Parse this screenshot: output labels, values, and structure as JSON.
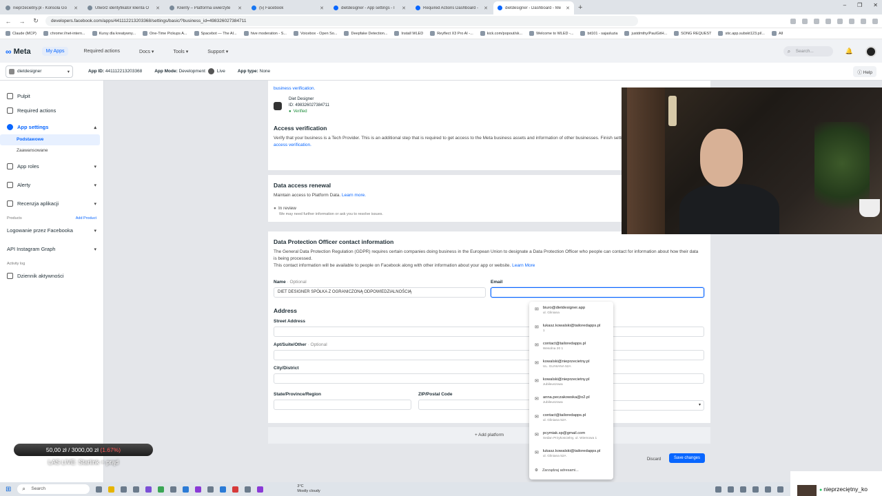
{
  "browser": {
    "tabs": [
      {
        "title": "nieprzecietny.pl - Konsola Go"
      },
      {
        "title": "Utwórz identyfikator klienta O"
      },
      {
        "title": "Klienty – Platforma uwierzyte"
      },
      {
        "title": "(5) Facebook"
      },
      {
        "title": "dietdesigner - App settings - I"
      },
      {
        "title": "Required Actions Dashboard -"
      },
      {
        "title": "dietdesigner - Dashboard - Me",
        "active": true
      }
    ],
    "new_tab": "+",
    "window_controls": [
      "–",
      "❐",
      "✕"
    ],
    "url": "developers.facebook.com/apps/441112213203368/settings/basic/?business_id=498326027384711",
    "bookmarks": [
      "Claude (MCP)",
      "chrome://net-intern...",
      "Kursy dla kreatywny...",
      "One-Time Pickups A...",
      "Spacebot — The AI...",
      "hive moderation - S...",
      "Voicebox - Open So...",
      "Deepfake Detection...",
      "Install WLED",
      "Reyflect X3 Pro AI -...",
      "kick.com/popout/sk...",
      "Welcome to WLED -...",
      "bit101 - sajasluzia",
      "justdmthy/PaulGitH...",
      "SONG REQUEST",
      "stic.app.subskt123.pl/...",
      "All"
    ]
  },
  "meta_header": {
    "logo": "Meta",
    "nav": [
      "My Apps",
      "Required actions",
      "Docs ▾",
      "Tools ▾",
      "Support ▾"
    ],
    "search_placeholder": "Search..."
  },
  "app_row": {
    "app_name": "dietdesigner",
    "app_id_label": "App ID:",
    "app_id": "441112213203368",
    "app_mode_label": "App Mode:",
    "app_mode": "Development",
    "live": "Live",
    "app_type_label": "App type:",
    "app_type": "None",
    "help": "Help"
  },
  "sidebar": {
    "items": [
      {
        "label": "Pulpit"
      },
      {
        "label": "Required actions"
      },
      {
        "label": "App settings"
      },
      {
        "label": "App roles"
      },
      {
        "label": "Alerty"
      },
      {
        "label": "Recenzja aplikacji"
      },
      {
        "label": "Logowanie przez Facebooka"
      },
      {
        "label": "API Instagram Graph"
      },
      {
        "label": "Dziennik aktywności"
      }
    ],
    "sub_items": [
      "Podstawowe",
      "Zaawansowane"
    ],
    "products_label": "Products",
    "add_product": "Add Product",
    "activity_log_label": "Activity log"
  },
  "business": {
    "verification_link": "business verification.",
    "name": "Diet Designer",
    "id_text": "ID: 498326027384711",
    "status": "Verified"
  },
  "access_verification": {
    "title": "Access verification",
    "desc": "Verify that your business is a Tech Provider. This is an additional step that is required to get access to the Meta business assets and information of other businesses. Finish setting it up within 5 days.",
    "link": "Learn about access verification."
  },
  "data_access": {
    "title": "Data access renewal",
    "desc": "Maintain access to Platform Data.",
    "link": "Learn more.",
    "status": "In review",
    "substatus": "We may need further information or ask you to resolve issues."
  },
  "dpo": {
    "title": "Data Protection Officer contact information",
    "desc1": "The General Data Protection Regulation (GDPR) requires certain companies doing business in the European Union to designate a Data Protection Officer who people can contact for information about how their data is being processed.",
    "desc2": "This contact information will be available to people on Facebook along with other information about your app or website.",
    "link": "Learn More",
    "name_label": "Name",
    "optional": "· Optional",
    "name_value": "DIET DESIGNER SPÓŁKA Z OGRANICZONĄ ODPOWIEDZIALNOŚCIĄ",
    "email_label": "Email",
    "email_value": "",
    "address_label": "Address",
    "street_label": "Street Address",
    "apt_label": "Apt/Suite/Other",
    "apt_optional": "· Optional",
    "city_label": "City/District",
    "state_label": "State/Province/Region",
    "zip_label": "ZIP/Postal Code"
  },
  "add_platform": "+ Add platform",
  "buttons": {
    "discard": "Discard",
    "save": "Save changes"
  },
  "autocomplete": {
    "items": [
      {
        "email": "biuro@dietdesigner.app",
        "sub": "ul. Gliniana"
      },
      {
        "email": "lukasz.kowalski@tailoredapps.pl",
        "sub": "1"
      },
      {
        "email": "contact@tailoredapps.pl",
        "sub": "Wesolna 20 1"
      },
      {
        "email": "kowalski@nieprzecietny.pl",
        "sub": "UL. GLINIANA 52A"
      },
      {
        "email": "kowalski@nieprzecietny.pl",
        "sub": "Jubileuszowa"
      },
      {
        "email": "anna.peczakowska@o2.pl",
        "sub": "Jubileuszowa"
      },
      {
        "email": "contact@tailoredapps.pl",
        "sub": "ul. Gliniana 52A"
      },
      {
        "email": "pcymiak.sp@gmail.com",
        "sub": "Sedan Przykoscielny, ul. Wiemowa 1"
      },
      {
        "email": "lukasz.kowalski@tailoredapps.pl",
        "sub": "ul. Gliniana 52A"
      }
    ],
    "manage": "Zarządzaj adresami..."
  },
  "overlay": {
    "donation_current": "50,00 zł",
    "donation_sep": " / ",
    "donation_goal": "3000,00 zł",
    "donation_pct": "(1.67%)",
    "live_title": "LAS LIVE: Starlink + prąd",
    "streamer": "nieprzeciętny_ko"
  },
  "taskbar": {
    "search": "Search",
    "weather_temp": "3°C",
    "weather_desc": "Mostly cloudy"
  }
}
